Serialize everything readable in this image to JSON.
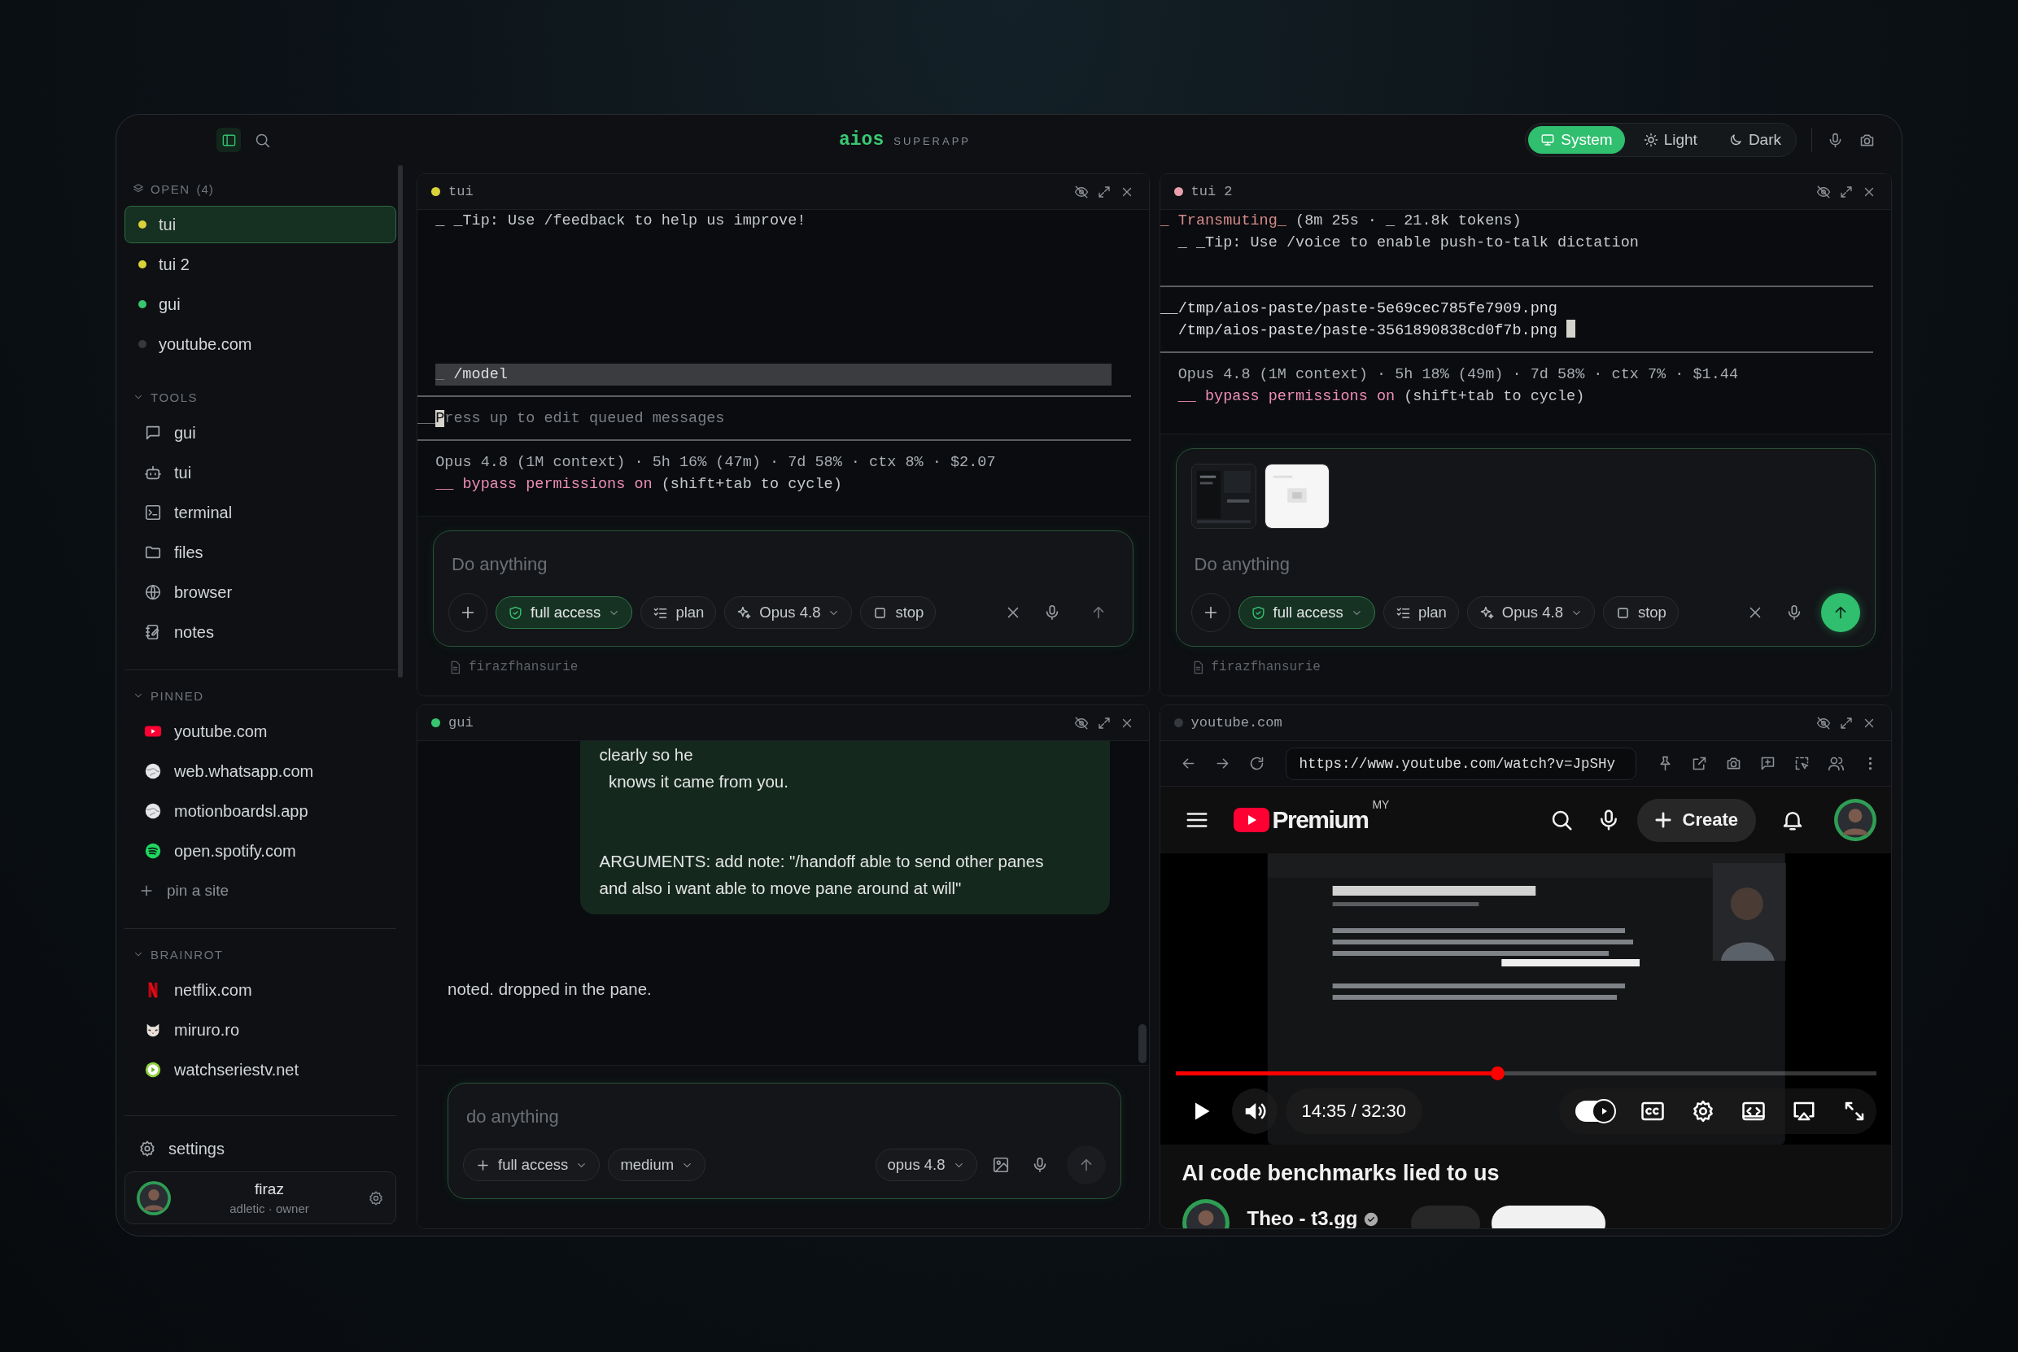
{
  "topbar": {
    "brand": "aios",
    "tagline": "SUPERAPP",
    "themes": [
      {
        "label": "System",
        "selected": true
      },
      {
        "label": "Light",
        "selected": false
      },
      {
        "label": "Dark",
        "selected": false
      }
    ]
  },
  "sidebar": {
    "sections": [
      {
        "kind": "open",
        "title": "OPEN",
        "count": "(4)",
        "items": [
          {
            "label": "tui",
            "color": "#d9d23a",
            "selected": true
          },
          {
            "label": "tui 2",
            "color": "#d9d23a",
            "selected": false
          },
          {
            "label": "gui",
            "color": "#38c56f",
            "selected": false
          },
          {
            "label": "youtube.com",
            "color": "#35383d",
            "selected": false
          }
        ]
      },
      {
        "kind": "group",
        "title": "TOOLS",
        "expanded": true,
        "items": [
          {
            "label": "gui",
            "selected": false
          },
          {
            "label": "tui",
            "selected": false
          },
          {
            "label": "terminal",
            "selected": false
          },
          {
            "label": "files",
            "selected": false
          },
          {
            "label": "browser",
            "selected": false
          },
          {
            "label": "notes",
            "selected": false
          }
        ]
      },
      {
        "kind": "group",
        "title": "PINNED",
        "expanded": true,
        "action": "pin a site",
        "items": [
          {
            "label": "youtube.com",
            "selected": false
          },
          {
            "label": "web.whatsapp.com",
            "selected": false
          },
          {
            "label": "motionboardsl.app",
            "selected": false
          },
          {
            "label": "open.spotify.com",
            "selected": false
          }
        ]
      },
      {
        "kind": "group",
        "title": "BRAINROT",
        "expanded": true,
        "items": [
          {
            "label": "netflix.com",
            "selected": false
          },
          {
            "label": "miruro.ro",
            "selected": false
          },
          {
            "label": "watchseriestv.net",
            "selected": false
          }
        ]
      }
    ],
    "settings": "settings",
    "user": {
      "name": "firaz",
      "role": "adletic · owner"
    }
  },
  "panes": [
    {
      "kind": "terminal",
      "title": "tui",
      "color": "#d9d23a",
      "lines": [
        {
          "kind": "text",
          "segments": [
            {
              "text": "_ _Tip: Use /feedback to help us improve!",
              "color": "#c6c9cc"
            }
          ]
        },
        {
          "kind": "blank"
        },
        {
          "kind": "blank"
        },
        {
          "kind": "blank"
        },
        {
          "kind": "blank"
        },
        {
          "kind": "blank"
        },
        {
          "kind": "blank"
        },
        {
          "kind": "highlight",
          "segments": [
            {
              "text": "_ ",
              "color": "#76797d"
            },
            {
              "text": "/model",
              "color": "#dcdee0"
            }
          ]
        },
        {
          "kind": "rule"
        },
        {
          "kind": "text",
          "prefix": "__",
          "segments": [
            {
              "text": "P",
              "color": "#121212",
              "cursor": true
            },
            {
              "text": "ress up to edit queued messages",
              "color": "#7b8086"
            }
          ]
        },
        {
          "kind": "rule"
        },
        {
          "kind": "text",
          "segments": [
            {
              "text": "Opus 4.8 (1M context) · 5h 16% (47m) · 7d 58% · ctx 8% · $2.07",
              "color": "#a9adb1"
            }
          ]
        },
        {
          "kind": "text",
          "segments": [
            {
              "text": "__ bypass permissions on",
              "color": "#ee8fb6"
            },
            {
              "text": " (shift+tab to cycle)",
              "color": "#c6c9cc"
            }
          ]
        }
      ],
      "composer": {
        "kind": "agent",
        "placeholder": "Do anything",
        "chips": [
          {
            "kind": "access",
            "label": "full access",
            "dropdown": true,
            "selected": true
          },
          {
            "kind": "plan",
            "label": "plan",
            "dropdown": false,
            "selected": false
          },
          {
            "kind": "model",
            "label": "Opus 4.8",
            "dropdown": true,
            "selected": false
          },
          {
            "kind": "stop",
            "label": "stop",
            "dropdown": false,
            "selected": false
          }
        ],
        "send_active": false
      },
      "footer": "firazfhansurie"
    },
    {
      "kind": "terminal",
      "title": "tui 2",
      "color": "#e8a0ad",
      "lines": [
        {
          "kind": "text",
          "prefix": "_",
          "segments": [
            {
              "text": "Transmuting_",
              "color": "#d58a8a"
            },
            {
              "text": " (8m 25s · _ 21.8k tokens)",
              "color": "#c6c9cc"
            }
          ]
        },
        {
          "kind": "text",
          "segments": [
            {
              "text": "_ _Tip: Use /voice to enable push-to-talk dictation",
              "color": "#c6c9cc"
            }
          ]
        },
        {
          "kind": "blank"
        },
        {
          "kind": "rule"
        },
        {
          "kind": "text",
          "prefix": "__",
          "segments": [
            {
              "text": "/tmp/aios-paste/paste-5e69cec785fe7909.png",
              "color": "#dcdee0"
            }
          ]
        },
        {
          "kind": "text",
          "cursor": true,
          "segments": [
            {
              "text": "/tmp/aios-paste/paste-3561890838cd0f7b.png",
              "color": "#dcdee0"
            }
          ]
        },
        {
          "kind": "rule"
        },
        {
          "kind": "text",
          "segments": [
            {
              "text": "Opus 4.8 (1M context) · 5h 18% (49m) · 7d 58% · ctx 7% · $1.44",
              "color": "#a9adb1"
            }
          ]
        },
        {
          "kind": "text",
          "segments": [
            {
              "text": "__ bypass permissions on",
              "color": "#ee8fb6"
            },
            {
              "text": " (shift+tab to cycle)",
              "color": "#c6c9cc"
            }
          ]
        }
      ],
      "composer": {
        "kind": "agent",
        "placeholder": "Do anything",
        "chips": [
          {
            "kind": "access",
            "label": "full access",
            "dropdown": true,
            "selected": true
          },
          {
            "kind": "plan",
            "label": "plan",
            "dropdown": false,
            "selected": false
          },
          {
            "kind": "model",
            "label": "Opus 4.8",
            "dropdown": true,
            "selected": false
          },
          {
            "kind": "stop",
            "label": "stop",
            "dropdown": false,
            "selected": false
          }
        ],
        "send_active": true
      },
      "footer": "firazfhansurie"
    },
    {
      "kind": "chat",
      "title": "gui",
      "color": "#38c56f",
      "messages": [
        {
          "kind": "user",
          "paragraphs": [
            "clearly so he\n  knows it came from you.",
            "ARGUMENTS: add note: \"/handoff able to send other panes and also i want able to move pane around at will\""
          ]
        },
        {
          "kind": "assistant",
          "paragraphs": [
            "noted. dropped in the pane."
          ]
        }
      ],
      "composer": {
        "kind": "chat",
        "placeholder": "do anything",
        "chips": [
          {
            "kind": "add",
            "label": "full access",
            "dropdown": true,
            "selected": false
          },
          {
            "kind": "plain",
            "label": "medium",
            "dropdown": true,
            "selected": false
          }
        ],
        "end_chips": [
          {
            "kind": "plain",
            "label": "opus 4.8",
            "dropdown": true,
            "selected": false
          }
        ],
        "send_active": false
      }
    },
    {
      "kind": "browser",
      "title": "youtube.com",
      "color": "#35383d",
      "url": "https://www.youtube.com/watch?v=JpSHy",
      "page": {
        "brand": "Premium",
        "region": "MY",
        "create": "Create",
        "video": {
          "kind": "picture",
          "level": 0.45,
          "time": "14:35 / 32:30",
          "autoplay": true
        },
        "title": "AI code benchmarks lied to us",
        "channel": "Theo - t3.gg",
        "verified": true
      }
    }
  ]
}
